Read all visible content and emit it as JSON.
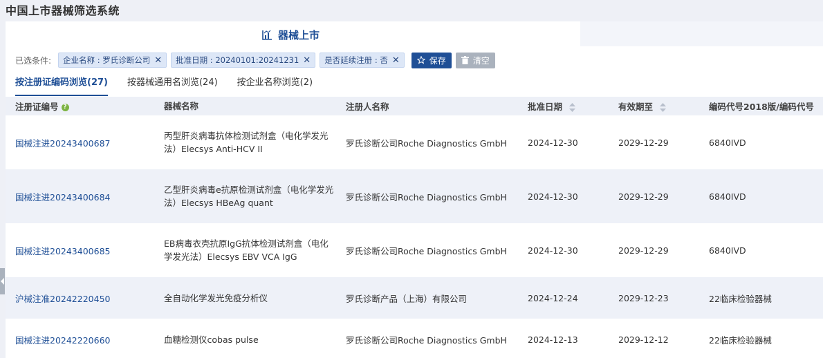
{
  "app": {
    "title": "中国上市器械筛选系统"
  },
  "panel": {
    "title": "器械上市"
  },
  "filters": {
    "label": "已选条件:",
    "chips": [
      {
        "text": "企业名称 : 罗氏诊断公司"
      },
      {
        "text": "批准日期 : 20240101:20241231"
      },
      {
        "text": "是否延续注册 : 否"
      }
    ],
    "save_label": "保存",
    "clear_label": "清空",
    "close_glyph": "✕"
  },
  "tabs": [
    {
      "label": "按注册证编码浏览(27)",
      "active": true
    },
    {
      "label": "按器械通用名浏览(24)",
      "active": false
    },
    {
      "label": "按企业名称浏览(2)",
      "active": false
    }
  ],
  "table": {
    "headers": [
      "注册证编号",
      "器械名称",
      "注册人名称",
      "批准日期",
      "有效期至",
      "编码代号2018版/编码代号"
    ],
    "rows": [
      {
        "reg_no": "国械注进20243400687",
        "device": "丙型肝炎病毒抗体检测试剂盒（电化学发光法）Elecsys Anti-HCV II",
        "registrant": "罗氏诊断公司Roche Diagnostics GmbH",
        "approved": "2024-12-30",
        "valid_until": "2029-12-29",
        "code": "6840IVD"
      },
      {
        "reg_no": "国械注进20243400684",
        "device": "乙型肝炎病毒e抗原检测试剂盒（电化学发光法）Elecsys HBeAg quant",
        "registrant": "罗氏诊断公司Roche Diagnostics GmbH",
        "approved": "2024-12-30",
        "valid_until": "2029-12-29",
        "code": "6840IVD"
      },
      {
        "reg_no": "国械注进20243400685",
        "device": "EB病毒衣壳抗原IgG抗体检测试剂盒（电化学发光法）Elecsys EBV VCA IgG",
        "registrant": "罗氏诊断公司Roche Diagnostics GmbH",
        "approved": "2024-12-30",
        "valid_until": "2029-12-29",
        "code": "6840IVD"
      },
      {
        "reg_no": "沪械注准20242220450",
        "device": "全自动化学发光免疫分析仪",
        "registrant": "罗氏诊断产品（上海）有限公司",
        "approved": "2024-12-24",
        "valid_until": "2029-12-23",
        "code": "22临床检验器械"
      },
      {
        "reg_no": "国械注进20242220660",
        "device": "血糖检测仪cobas pulse",
        "registrant": "罗氏诊断公司Roche Diagnostics GmbH",
        "approved": "2024-12-13",
        "valid_until": "2029-12-12",
        "code": "22临床检验器械"
      }
    ]
  },
  "colors": {
    "accent": "#1f4f96",
    "chip_bg": "#dde7f7",
    "row_alt": "#eef1f8",
    "help": "#7cb342"
  }
}
